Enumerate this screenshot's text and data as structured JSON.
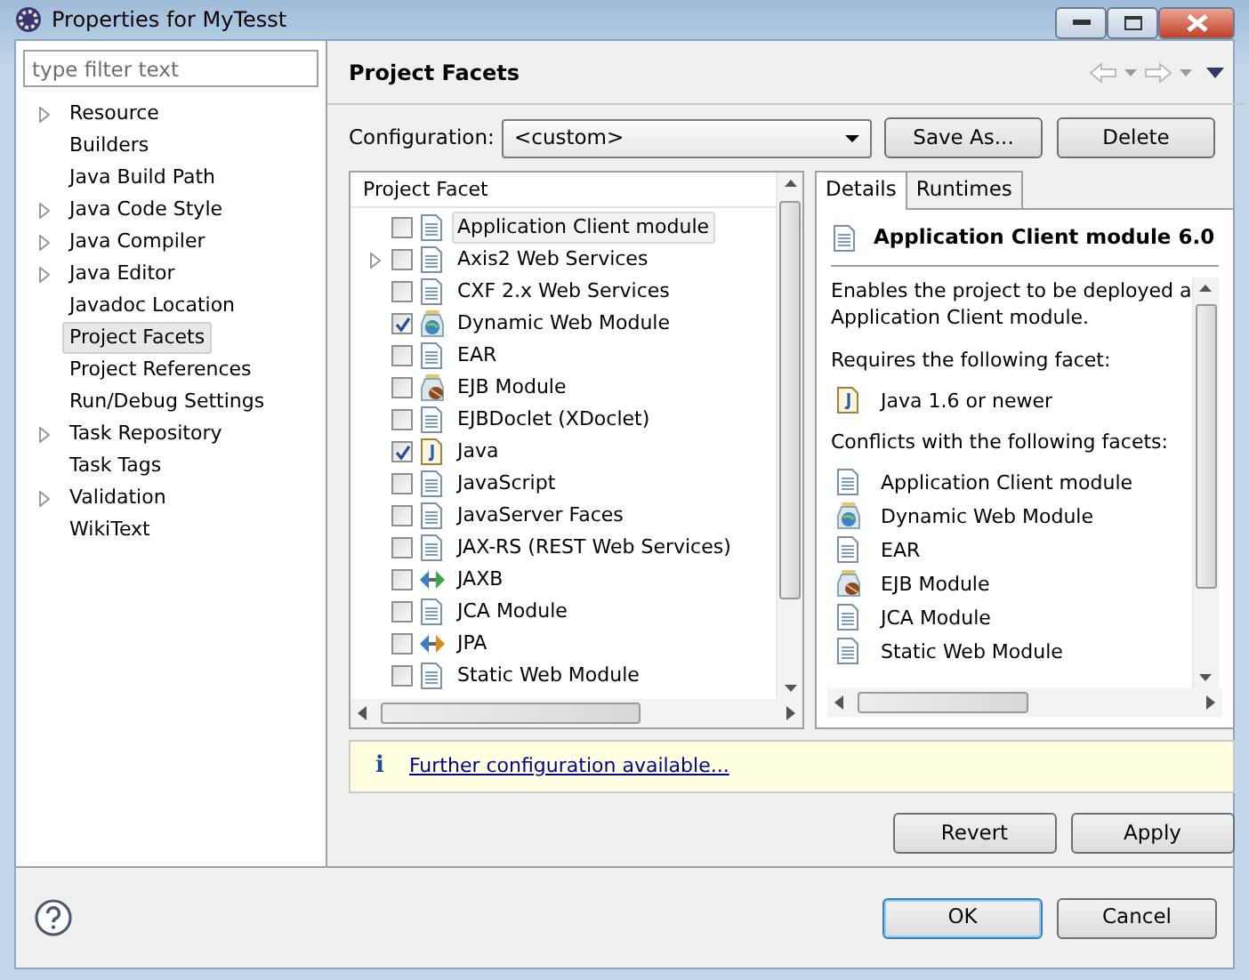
{
  "window": {
    "title": "Properties for MyTesst"
  },
  "filter": {
    "placeholder": "type filter text"
  },
  "tree": [
    {
      "label": "Resource",
      "expandable": true,
      "selected": false
    },
    {
      "label": "Builders",
      "expandable": false,
      "selected": false
    },
    {
      "label": "Java Build Path",
      "expandable": false,
      "selected": false
    },
    {
      "label": "Java Code Style",
      "expandable": true,
      "selected": false
    },
    {
      "label": "Java Compiler",
      "expandable": true,
      "selected": false
    },
    {
      "label": "Java Editor",
      "expandable": true,
      "selected": false
    },
    {
      "label": "Javadoc Location",
      "expandable": false,
      "selected": false
    },
    {
      "label": "Project Facets",
      "expandable": false,
      "selected": true
    },
    {
      "label": "Project References",
      "expandable": false,
      "selected": false
    },
    {
      "label": "Run/Debug Settings",
      "expandable": false,
      "selected": false
    },
    {
      "label": "Task Repository",
      "expandable": true,
      "selected": false
    },
    {
      "label": "Task Tags",
      "expandable": false,
      "selected": false
    },
    {
      "label": "Validation",
      "expandable": true,
      "selected": false
    },
    {
      "label": "WikiText",
      "expandable": false,
      "selected": false
    }
  ],
  "page": {
    "title": "Project Facets"
  },
  "configuration": {
    "label": "Configuration:",
    "value": "<custom>",
    "buttons": [
      "Save As...",
      "Delete"
    ]
  },
  "facets": {
    "column": "Project Facet",
    "rows": [
      {
        "label": "Application Client module",
        "kind": "doc",
        "checked": false,
        "selected": true,
        "expandable": false
      },
      {
        "label": "Axis2 Web Services",
        "kind": "doc",
        "checked": false,
        "selected": false,
        "expandable": true
      },
      {
        "label": "CXF 2.x Web Services",
        "kind": "doc",
        "checked": false,
        "selected": false,
        "expandable": false
      },
      {
        "label": "Dynamic Web Module",
        "kind": "web",
        "checked": true,
        "selected": false,
        "expandable": false
      },
      {
        "label": "EAR",
        "kind": "doc",
        "checked": false,
        "selected": false,
        "expandable": false
      },
      {
        "label": "EJB Module",
        "kind": "ejb",
        "checked": false,
        "selected": false,
        "expandable": false
      },
      {
        "label": "EJBDoclet (XDoclet)",
        "kind": "doc",
        "checked": false,
        "selected": false,
        "expandable": false
      },
      {
        "label": "Java",
        "kind": "java",
        "checked": true,
        "selected": false,
        "expandable": false
      },
      {
        "label": "JavaScript",
        "kind": "doc",
        "checked": false,
        "selected": false,
        "expandable": false
      },
      {
        "label": "JavaServer Faces",
        "kind": "doc",
        "checked": false,
        "selected": false,
        "expandable": false
      },
      {
        "label": "JAX-RS (REST Web Services)",
        "kind": "doc",
        "checked": false,
        "selected": false,
        "expandable": false
      },
      {
        "label": "JAXB",
        "kind": "jaxb",
        "checked": false,
        "selected": false,
        "expandable": false
      },
      {
        "label": "JCA Module",
        "kind": "doc",
        "checked": false,
        "selected": false,
        "expandable": false
      },
      {
        "label": "JPA",
        "kind": "jpa",
        "checked": false,
        "selected": false,
        "expandable": false
      },
      {
        "label": "Static Web Module",
        "kind": "doc",
        "checked": false,
        "selected": false,
        "expandable": false
      }
    ]
  },
  "tabs": [
    {
      "label": "Details",
      "selected": true
    },
    {
      "label": "Runtimes",
      "selected": false
    }
  ],
  "details": {
    "title": "Application Client module 6.0",
    "description": "Enables the project to be deployed a",
    "description_2": "Application Client module.",
    "requires_label": "Requires the following facet:",
    "requires": [
      {
        "label": "Java 1.6 or newer",
        "kind": "java"
      }
    ],
    "conflicts_label": "Conflicts with the following facets:",
    "conflicts": [
      {
        "label": "Application Client module",
        "kind": "doc"
      },
      {
        "label": "Dynamic Web Module",
        "kind": "web"
      },
      {
        "label": "EAR",
        "kind": "doc"
      },
      {
        "label": "EJB Module",
        "kind": "ejb"
      },
      {
        "label": "JCA Module",
        "kind": "doc"
      },
      {
        "label": "Static Web Module",
        "kind": "doc"
      }
    ]
  },
  "info": {
    "icon": "i",
    "link": "Further configuration available..."
  },
  "page_buttons": [
    "Revert",
    "Apply"
  ],
  "dialog_buttons": [
    {
      "label": "OK",
      "default": true
    },
    {
      "label": "Cancel",
      "default": false
    }
  ]
}
